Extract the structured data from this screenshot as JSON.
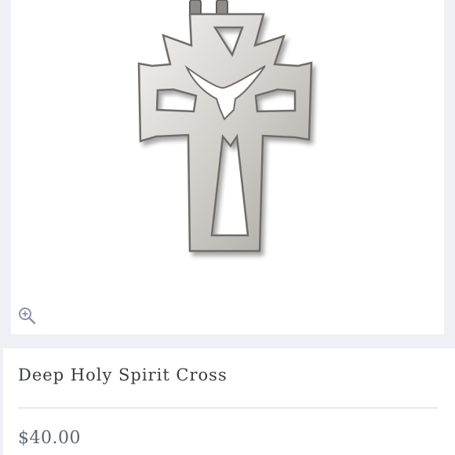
{
  "product": {
    "image_icon": "cross-pendant-image",
    "zoom_icon": "zoom-in-icon",
    "title": "Deep Holy Spirit Cross",
    "price": "$40.00"
  },
  "colors": {
    "background": "#eef0f5",
    "panel": "#ffffff",
    "title_text": "#3a3c42",
    "price_text": "#5d6574",
    "zoom_icon": "#8a93a6",
    "metal": "#c9c7c3"
  }
}
